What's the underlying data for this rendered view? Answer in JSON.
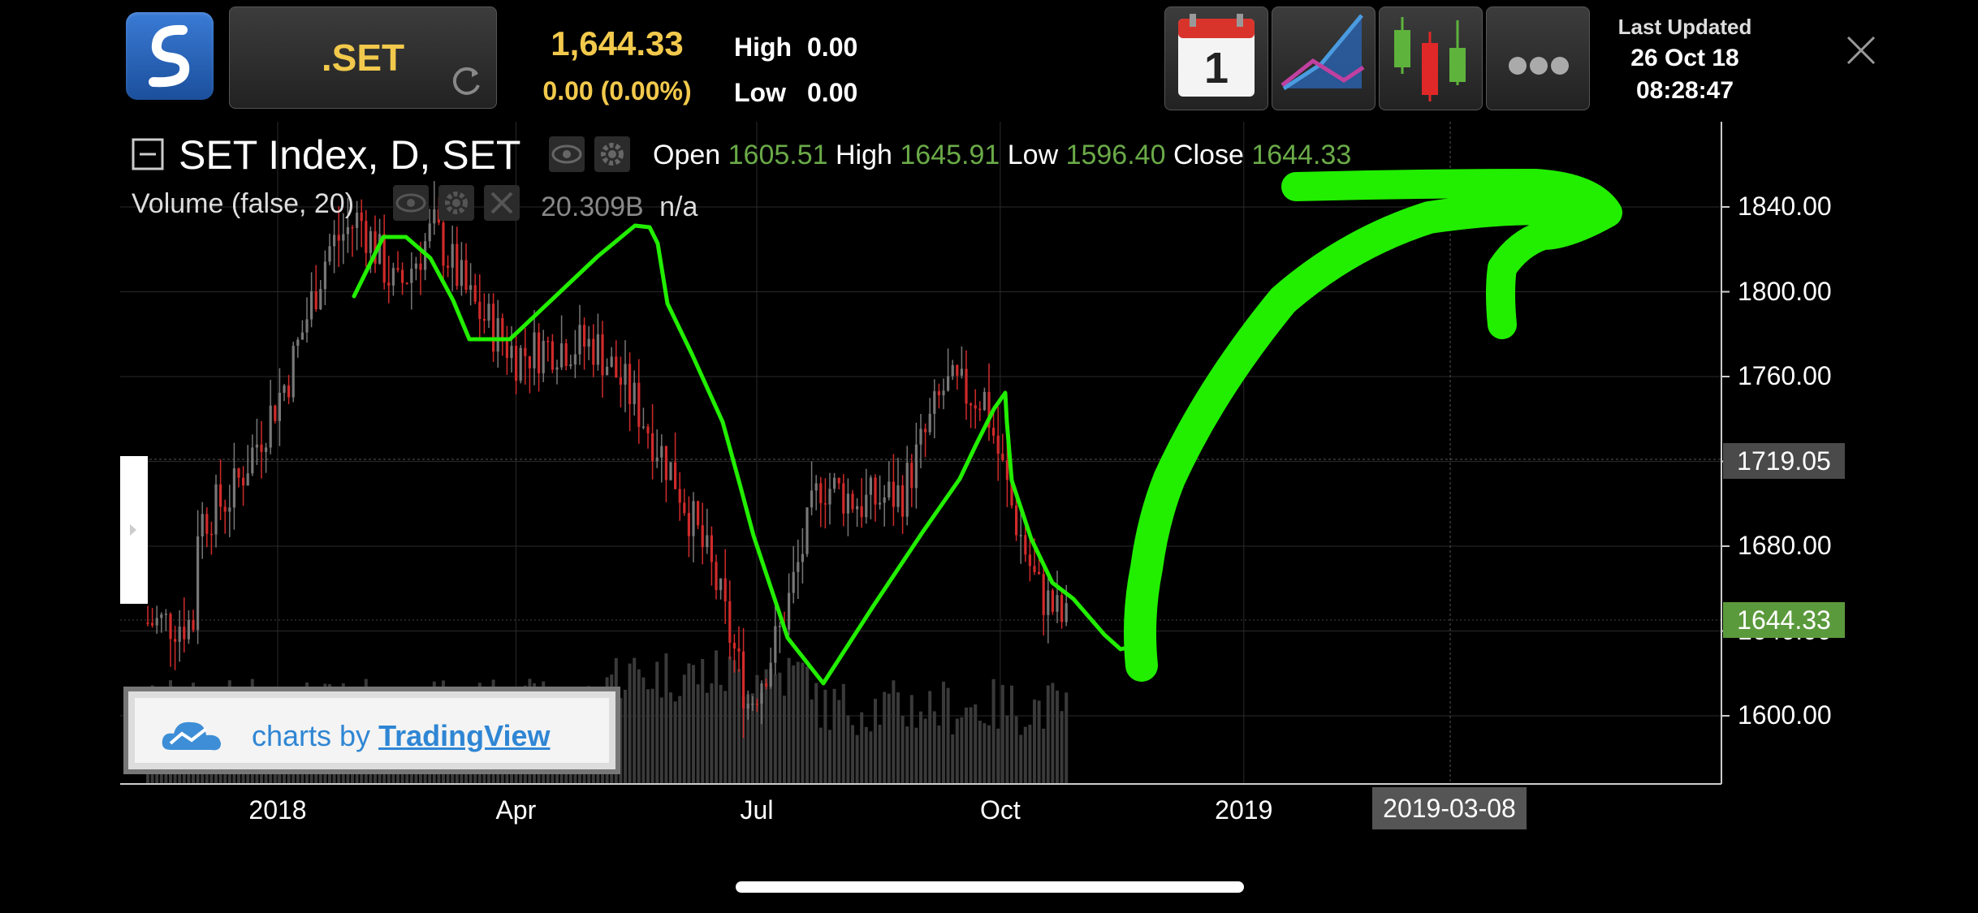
{
  "header": {
    "symbol": ".SET",
    "price": "1,644.33",
    "change": "0.00 (0.00%)",
    "high_label": "High",
    "high_value": "0.00",
    "low_label": "Low",
    "low_value": "0.00",
    "calendar_day": "1",
    "last_updated_label": "Last Updated",
    "last_updated_date": "26 Oct 18",
    "last_updated_time": "08:28:47"
  },
  "chart": {
    "title": "SET Index, D, SET",
    "open_label": "Open",
    "open_value": "1605.51",
    "high_label": "High",
    "high_value": "1645.91",
    "low_label": "Low",
    "low_value": "1596.40",
    "close_label": "Close",
    "close_value": "1644.33",
    "volume_label": "Volume (false, 20)",
    "volume_value": "20.309B",
    "volume_na": "n/a",
    "crosshair_price": "1719.05",
    "last_price": "1644.33",
    "crosshair_date": "2019-03-08",
    "branding_prefix": "charts by",
    "branding_link": "TradingView"
  },
  "colors": {
    "accent_gold": "#f2c94c",
    "up_value": "#6aaa48",
    "last_price_bg": "#5b9a3c",
    "annotation": "#22ee00",
    "candle_up": "#777777",
    "candle_down": "#d02a2a"
  },
  "chart_data": {
    "type": "candlestick",
    "y_axis": {
      "min": 1560,
      "max": 1880,
      "ticks": [
        "1600.00",
        "1640.00",
        "1680.00",
        "1720.00",
        "1760.00",
        "1800.00",
        "1840.00"
      ]
    },
    "x_ticks": [
      "2018",
      "Apr",
      "Jul",
      "Oct",
      "2019"
    ],
    "series": [
      {
        "name": "SET Index",
        "close_points": [
          [
            "2017-12-01",
            1690
          ],
          [
            "2017-12-15",
            1705
          ],
          [
            "2018-01-05",
            1760
          ],
          [
            "2018-01-20",
            1820
          ],
          [
            "2018-02-01",
            1835
          ],
          [
            "2018-02-15",
            1800
          ],
          [
            "2018-03-01",
            1830
          ],
          [
            "2018-03-15",
            1795
          ],
          [
            "2018-04-01",
            1770
          ],
          [
            "2018-04-15",
            1775
          ],
          [
            "2018-05-01",
            1775
          ],
          [
            "2018-05-15",
            1750
          ],
          [
            "2018-06-01",
            1710
          ],
          [
            "2018-06-15",
            1665
          ],
          [
            "2018-06-28",
            1605
          ],
          [
            "2018-07-10",
            1640
          ],
          [
            "2018-07-25",
            1710
          ],
          [
            "2018-08-10",
            1700
          ],
          [
            "2018-08-25",
            1705
          ],
          [
            "2018-09-10",
            1755
          ],
          [
            "2018-09-25",
            1750
          ],
          [
            "2018-10-05",
            1700
          ],
          [
            "2018-10-15",
            1660
          ],
          [
            "2018-10-25",
            1644
          ]
        ]
      }
    ]
  },
  "annotation": {
    "shape": "hand-drawn-trend-arrow"
  }
}
